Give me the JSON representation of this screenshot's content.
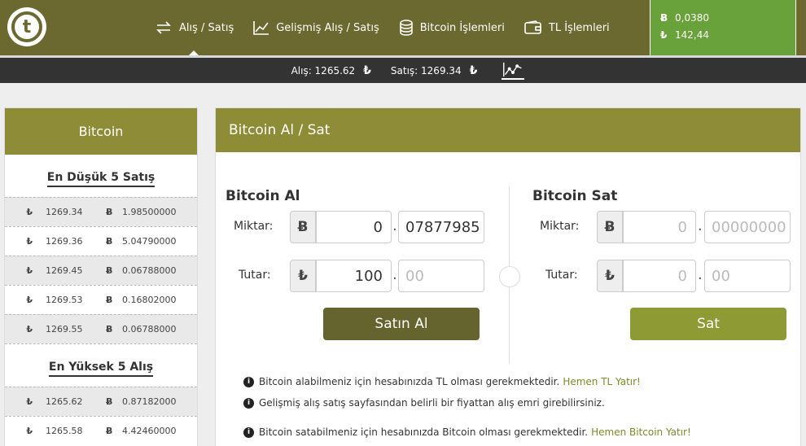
{
  "nav": {
    "items": [
      {
        "label": "Alış / Satış",
        "icon": "exchange-arrows-icon"
      },
      {
        "label": "Gelişmiş Alış / Satış",
        "icon": "line-chart-icon"
      },
      {
        "label": "Bitcoin İşlemleri",
        "icon": "coin-stack-icon"
      },
      {
        "label": "TL İşlemleri",
        "icon": "wallet-icon"
      }
    ]
  },
  "balance": {
    "btc_symbol": "Ƀ",
    "btc": "0,0380",
    "tl_symbol": "₺",
    "tl": "142,44"
  },
  "ticker": {
    "buy_label": "Alış: 1265.62",
    "sell_label": "Satış: 1269.34",
    "tl_symbol": "₺"
  },
  "left": {
    "title": "Bitcoin",
    "sell_title": "En Düşük 5 Satış",
    "buy_title": "En Yüksek 5 Alış",
    "sells": [
      {
        "price": "1269.34",
        "amount": "1.98500000"
      },
      {
        "price": "1269.36",
        "amount": "5.04790000"
      },
      {
        "price": "1269.45",
        "amount": "0.06788000"
      },
      {
        "price": "1269.53",
        "amount": "0.16802000"
      },
      {
        "price": "1269.55",
        "amount": "0.06788000"
      }
    ],
    "buys": [
      {
        "price": "1265.62",
        "amount": "0.87182000"
      },
      {
        "price": "1265.58",
        "amount": "4.42460000"
      }
    ],
    "tl_symbol": "₺",
    "btc_symbol": "Ƀ"
  },
  "main": {
    "title": "Bitcoin Al / Sat",
    "buy": {
      "title": "Bitcoin Al",
      "amount_label": "Miktar:",
      "total_label": "Tutar:",
      "amount_int": "0",
      "amount_dec": "07877985",
      "total_int": "100",
      "total_dec_placeholder": "00",
      "button": "Satın Al"
    },
    "sell": {
      "title": "Bitcoin Sat",
      "amount_label": "Miktar:",
      "total_label": "Tutar:",
      "amount_int_placeholder": "0",
      "amount_dec_placeholder": "00000000",
      "total_int_placeholder": "0",
      "total_dec_placeholder": "00",
      "button": "Sat"
    },
    "btc_symbol": "Ƀ",
    "tl_symbol": "₺",
    "dot": ".",
    "notes": [
      {
        "text": "Bitcoin alabilmeniz için hesabınızda TL olması gerekmektedir.",
        "link": "Hemen TL Yatır!"
      },
      {
        "text": "Gelişmiş alış satış sayfasından belirli bir fiyattan alış emri girebilirsiniz.",
        "link": ""
      },
      {
        "text": "Bitcoin satabilmeniz için hesabınızda Bitcoin olması gerekmektedir.",
        "link": "Hemen Bitcoin Yatır!"
      }
    ],
    "info_icon_glyph": "i"
  },
  "colors": {
    "brand": "#6b6930",
    "header": "#8e8c36",
    "balance_bg": "#69a13a",
    "link": "#7f8a2a"
  }
}
